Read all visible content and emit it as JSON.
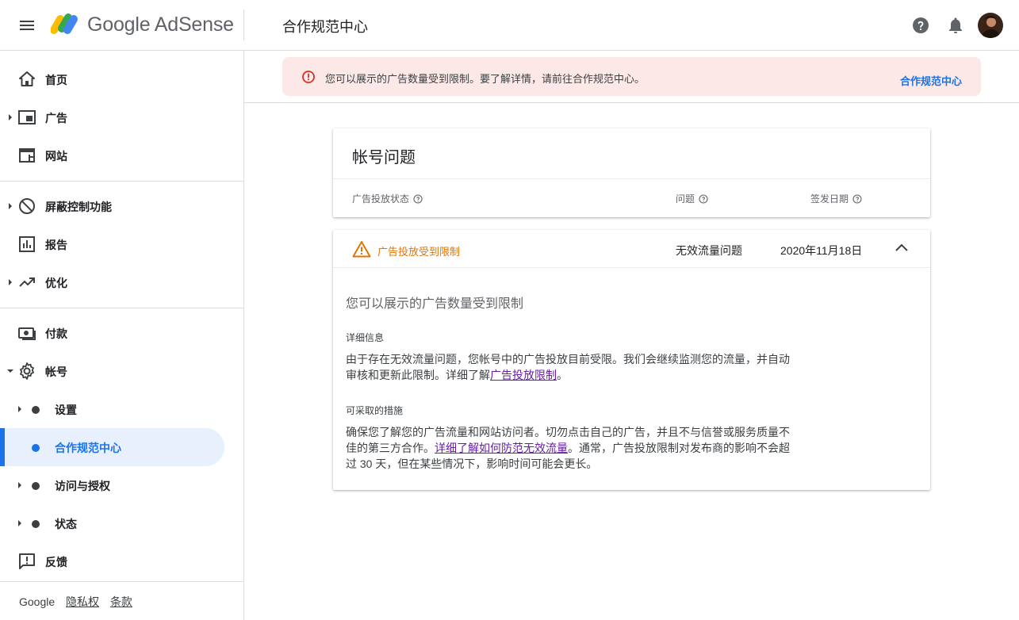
{
  "app": {
    "brand": "Google AdSense",
    "page_title": "合作规范中心"
  },
  "sidebar": {
    "items": [
      {
        "label": "首页"
      },
      {
        "label": "广告"
      },
      {
        "label": "网站"
      },
      {
        "label": "屏蔽控制功能"
      },
      {
        "label": "报告"
      },
      {
        "label": "优化"
      },
      {
        "label": "付款"
      },
      {
        "label": "帐号"
      }
    ],
    "sub_items": [
      {
        "label": "设置"
      },
      {
        "label": "合作规范中心"
      },
      {
        "label": "访问与授权"
      },
      {
        "label": "状态"
      }
    ],
    "feedback": "反馈",
    "footer": {
      "google": "Google",
      "privacy": "隐私权",
      "terms": "条款"
    }
  },
  "banner": {
    "text": "您可以展示的广告数量受到限制。要了解详情，请前往合作规范中心。",
    "link": "合作规范中心"
  },
  "account_issues": {
    "title": "帐号问题",
    "columns": [
      "广告投放状态",
      "问题",
      "签发日期"
    ]
  },
  "issue": {
    "status": "广告投放受到限制",
    "problem": "无效流量问题",
    "date": "2020年11月18日",
    "detail_title": "您可以展示的广告数量受到限制",
    "details_heading": "详细信息",
    "details_text": "由于存在无效流量问题，您帐号中的广告投放目前受限。我们会继续监测您的流量，并自动审核和更新此限制。详细了解",
    "details_link": "广告投放限制",
    "details_end": "。",
    "actions_heading": "可采取的措施",
    "actions_text": "确保您了解您的广告流量和网站访问者。切勿点击自己的广告，并且不与信誉或服务质量不佳的第三方合作。",
    "actions_link": "详细了解如何防范无效流量",
    "actions_end": "。通常，广告投放限制对发布商的影响不会超过 30 天，但在某些情况下，影响时间可能会更长。"
  },
  "colors": {
    "accent": "#1a73e8",
    "warning": "#e37400",
    "error": "#d93025",
    "banner_bg": "#fce8e6"
  }
}
